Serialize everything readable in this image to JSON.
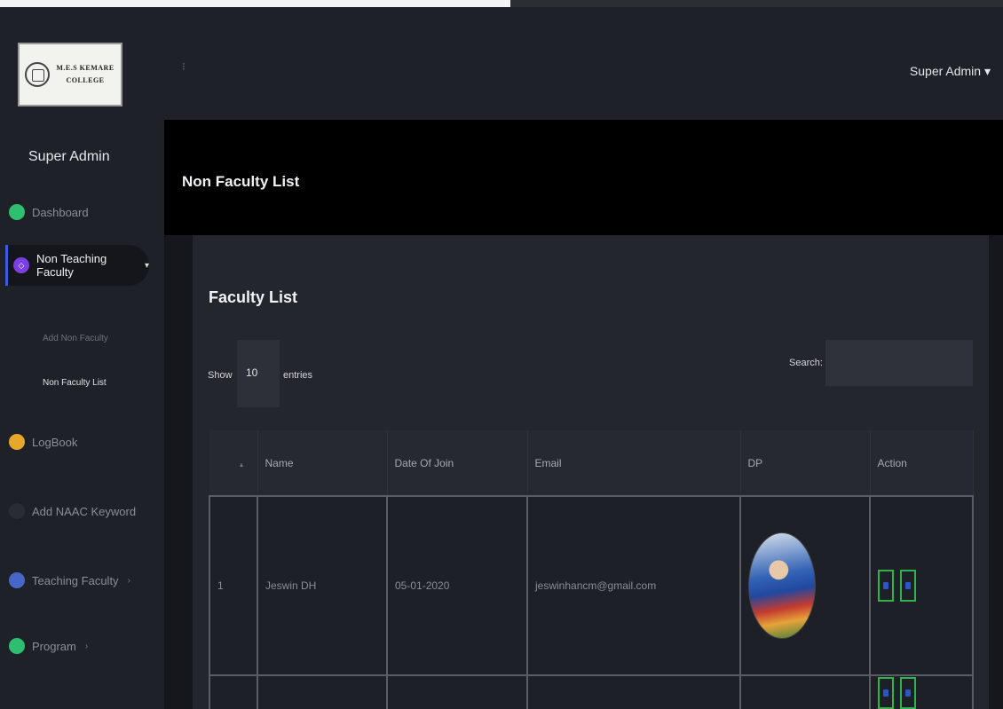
{
  "logo": {
    "line1": "M.E.S KEMARE",
    "line2": "COLLEGE",
    "icon": "college-seal-icon"
  },
  "sidebar": {
    "role": "Super Admin",
    "items": [
      {
        "label": "Dashboard",
        "icon": "dashboard-icon",
        "color": "#2fbf71"
      },
      {
        "label": "Non Teaching Faculty",
        "icon": "faculty-icon",
        "color": "#7b3fe4"
      },
      {
        "label": "LogBook",
        "icon": "logbook-icon",
        "color": "#e6a72b"
      },
      {
        "label": "Add NAAC Keyword",
        "icon": "keyword-icon",
        "color": "#2a2c34"
      },
      {
        "label": "Teaching Faculty",
        "icon": "teaching-icon",
        "color": "#4666c9"
      },
      {
        "label": "Program",
        "icon": "program-icon",
        "color": "#2fbf71"
      }
    ],
    "submenu": [
      "Add Non Faculty",
      "Non Faculty List"
    ]
  },
  "header": {
    "user_menu": "Super Admin",
    "toggle": "⁝"
  },
  "page": {
    "title": "Non Faculty List"
  },
  "card": {
    "title": "Faculty List",
    "show_label": "Show",
    "entries_value": "10",
    "entries_label": "entries",
    "search_label": "Search:"
  },
  "table": {
    "headers": [
      "",
      "Name",
      "Date Of Join",
      "Email",
      "DP",
      "Action"
    ],
    "rows": [
      {
        "no": "1",
        "name": "Jeswin DH",
        "date": "05-01-2020",
        "email": "jeswinhancm@gmail.com"
      }
    ]
  },
  "colors": {
    "accent": "#3c5be0",
    "success": "#33b14a"
  }
}
